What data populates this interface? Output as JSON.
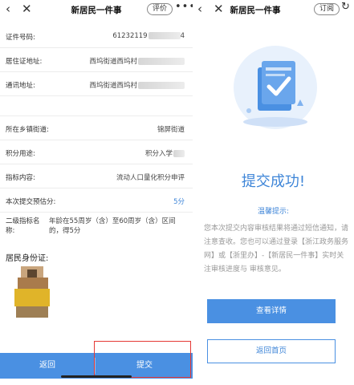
{
  "left": {
    "nav": {
      "title": "新居民一件事",
      "rate_label": "评价",
      "more": "•••",
      "back": "‹",
      "close": "✕"
    },
    "rows": [
      {
        "label": "证件号码:",
        "value": "61232119",
        "value_suffix": "4",
        "masked": true
      },
      {
        "label": "居住证地址:",
        "value": "西坞街道西坞村",
        "masked": true
      },
      {
        "label": "通讯地址:",
        "value": "西坞街道西坞村",
        "masked": true
      },
      {
        "label": "所在乡镇街道:",
        "value": "锦屏街道"
      },
      {
        "label": "积分用途:",
        "value": "积分入学",
        "masked": true
      },
      {
        "label": "指标内容:",
        "value": "流动人口量化积分申评"
      },
      {
        "label": "本次提交预估分:",
        "value": "5分",
        "highlight": true
      }
    ],
    "indicator": {
      "label": "二级指标名称:",
      "value": "年龄在55周岁（含）至60周岁（含）区间的，得5分"
    },
    "id_card_title": "居民身份证:",
    "bottom": {
      "back_label": "返回",
      "submit_label": "提交"
    }
  },
  "right": {
    "nav": {
      "title": "新居民一件事",
      "subscribe_label": "订阅",
      "back": "‹",
      "close": "✕",
      "refresh": "↻"
    },
    "success_title": "提交成功!",
    "tip_title": "温馨提示:",
    "tip_text": "您本次提交内容审核结果将通过短信通知，请注意查收。您也可以通过登录【浙江政务服务网】或【浙里办】-【新居民一件事】实时关注审核进度与 审核意见。",
    "detail_button": "查看详情",
    "home_button": "返回首页"
  },
  "colors": {
    "accent": "#4a90e2",
    "accent_text": "#3f86d8",
    "highlight_border": "#e53935"
  }
}
